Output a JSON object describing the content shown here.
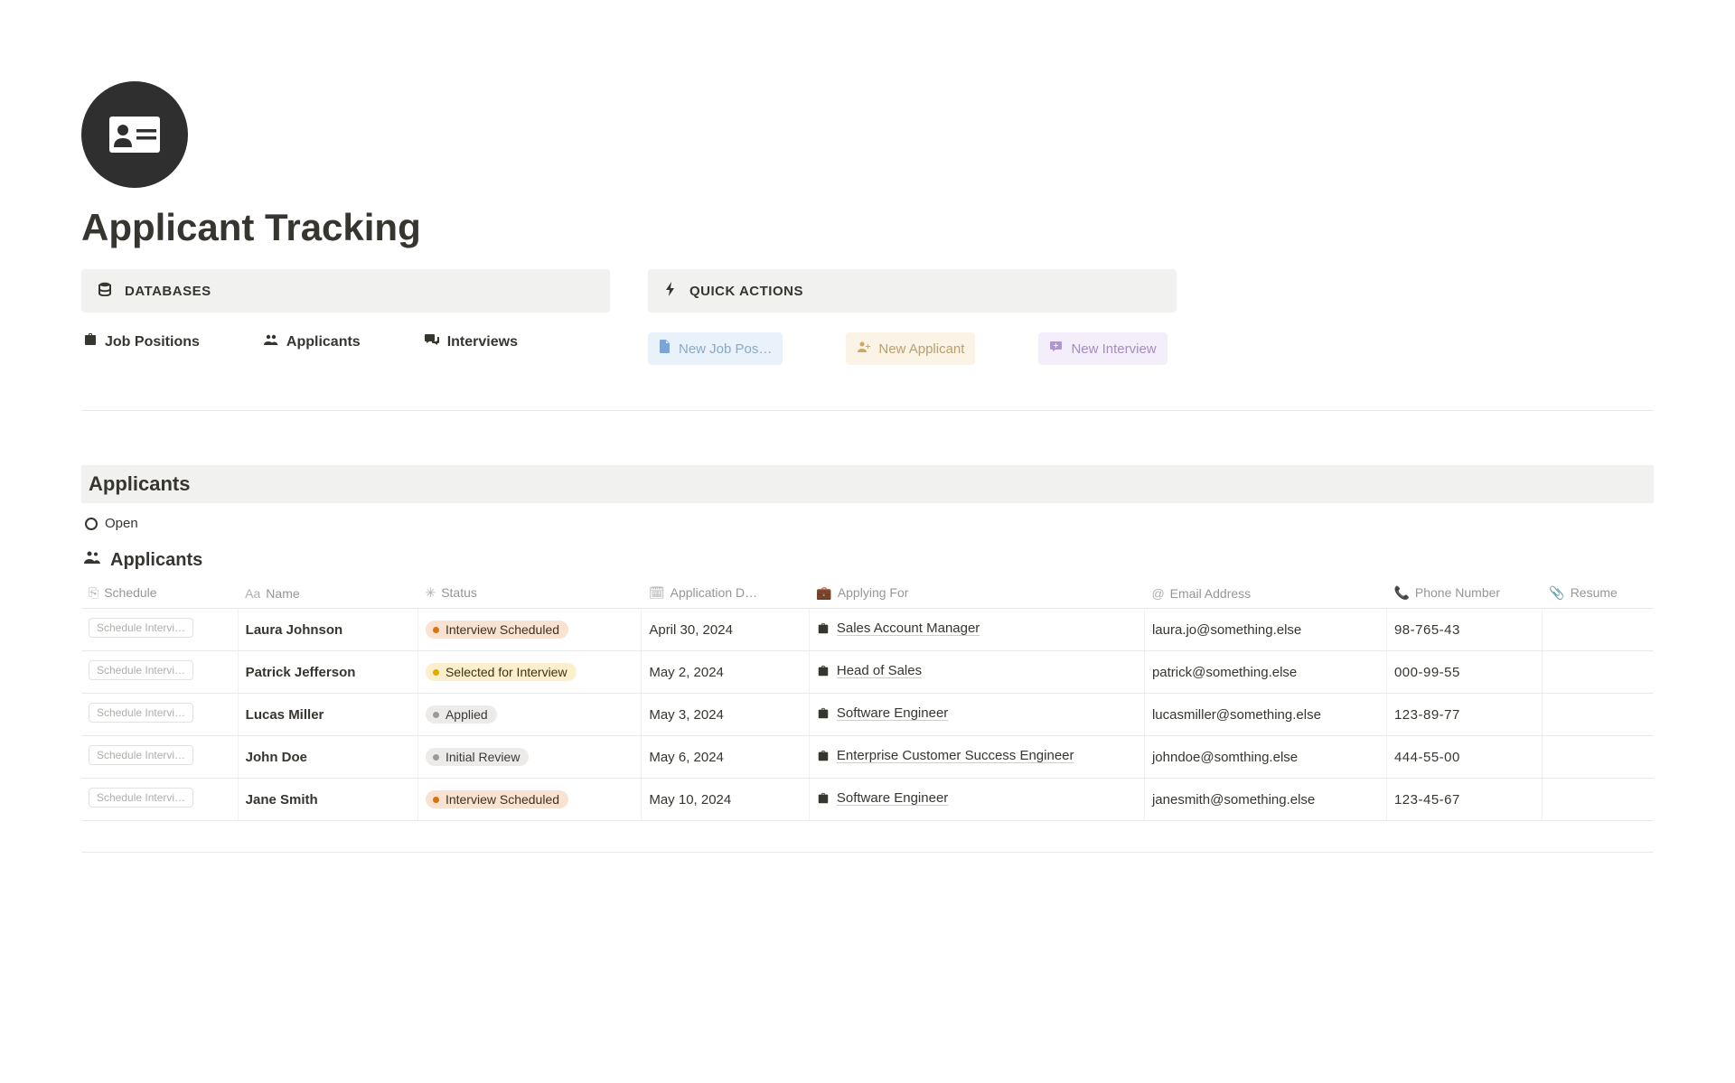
{
  "page": {
    "title": "Applicant Tracking"
  },
  "databases": {
    "label": "DATABASES",
    "links": [
      {
        "label": "Job Positions"
      },
      {
        "label": "Applicants"
      },
      {
        "label": "Interviews"
      }
    ]
  },
  "quick_actions": {
    "label": "QUICK ACTIONS",
    "items": [
      {
        "label": "New Job Pos…"
      },
      {
        "label": "New Applicant"
      },
      {
        "label": "New Interview"
      }
    ]
  },
  "applicants_section": {
    "header": "Applicants",
    "view_tab": "Open",
    "table_title": "Applicants"
  },
  "columns": {
    "schedule": "Schedule",
    "name": "Name",
    "status": "Status",
    "application_date": "Application D…",
    "applying_for": "Applying For",
    "email": "Email Address",
    "phone": "Phone Number",
    "resume": "Resume"
  },
  "rows": [
    {
      "schedule_btn": "Schedule Intervi…",
      "name": "Laura Johnson",
      "status": {
        "label": "Interview Scheduled",
        "color": "orange"
      },
      "date": "April 30, 2024",
      "applying_for": "Sales Account Manager",
      "email": "laura.jo@something.else",
      "phone": "98-765-43"
    },
    {
      "schedule_btn": "Schedule Intervi…",
      "name": "Patrick Jefferson",
      "status": {
        "label": "Selected for Interview",
        "color": "yellow"
      },
      "date": "May 2, 2024",
      "applying_for": "Head of Sales",
      "email": "patrick@something.else",
      "phone": "000-99-55"
    },
    {
      "schedule_btn": "Schedule Intervi…",
      "name": "Lucas Miller",
      "status": {
        "label": "Applied",
        "color": "gray"
      },
      "date": "May 3, 2024",
      "applying_for": "Software Engineer",
      "email": "lucasmiller@something.else",
      "phone": "123-89-77"
    },
    {
      "schedule_btn": "Schedule Intervi…",
      "name": "John Doe",
      "status": {
        "label": "Initial Review",
        "color": "gray"
      },
      "date": "May 6, 2024",
      "applying_for": "Enterprise Customer Success Engineer",
      "email": "johndoe@somthing.else",
      "phone": "444-55-00"
    },
    {
      "schedule_btn": "Schedule Intervi…",
      "name": "Jane Smith",
      "status": {
        "label": "Interview Scheduled",
        "color": "orange"
      },
      "date": "May 10, 2024",
      "applying_for": "Software Engineer",
      "email": "janesmith@something.else",
      "phone": "123-45-67"
    }
  ]
}
